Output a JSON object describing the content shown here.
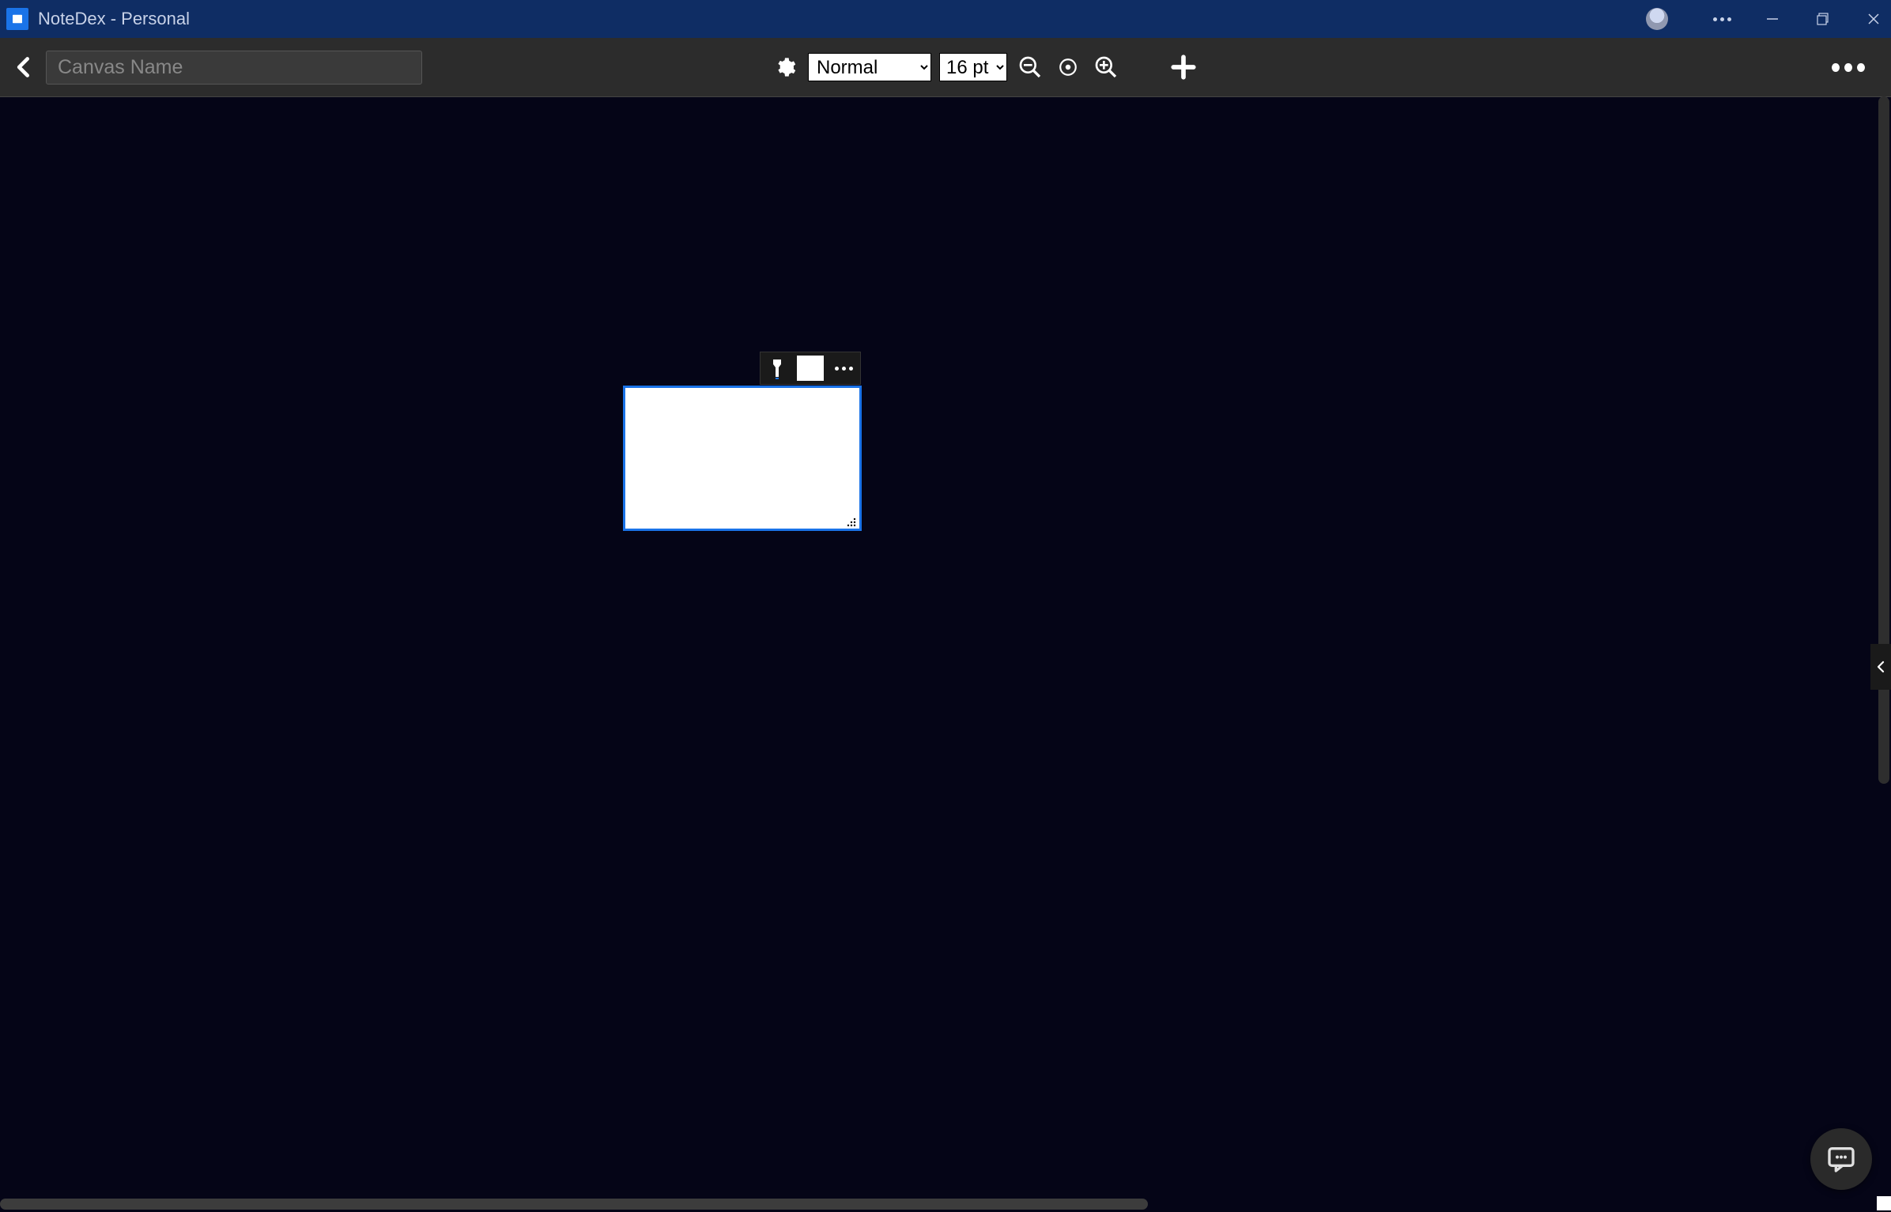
{
  "titlebar": {
    "title": "NoteDex - Personal"
  },
  "toolbar": {
    "canvas_name_placeholder": "Canvas Name",
    "style_select": "Normal",
    "size_select": "16 pt"
  }
}
